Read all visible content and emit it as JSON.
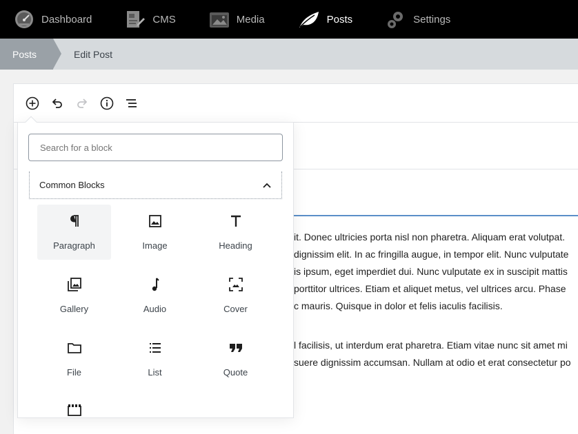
{
  "nav": {
    "items": [
      {
        "label": "Dashboard",
        "icon": "speedometer-icon",
        "active": false
      },
      {
        "label": "CMS",
        "icon": "cms-icon",
        "active": false
      },
      {
        "label": "Media",
        "icon": "media-icon",
        "active": false
      },
      {
        "label": "Posts",
        "icon": "leaf-icon",
        "active": true
      },
      {
        "label": "Settings",
        "icon": "gears-icon",
        "active": false
      }
    ]
  },
  "breadcrumb": {
    "parent": "Posts",
    "current": "Edit Post"
  },
  "toolbar": {
    "icons": [
      "add-block-icon",
      "undo-icon",
      "redo-icon",
      "info-icon",
      "outline-icon"
    ]
  },
  "inserter": {
    "search_placeholder": "Search for a block",
    "panel_title": "Common Blocks",
    "blocks": [
      {
        "label": "Paragraph",
        "icon": "paragraph-icon"
      },
      {
        "label": "Image",
        "icon": "image-icon"
      },
      {
        "label": "Heading",
        "icon": "heading-icon"
      },
      {
        "label": "Gallery",
        "icon": "gallery-icon"
      },
      {
        "label": "Audio",
        "icon": "audio-icon"
      },
      {
        "label": "Cover",
        "icon": "cover-icon"
      },
      {
        "label": "File",
        "icon": "folder-icon"
      },
      {
        "label": "List",
        "icon": "list-icon"
      },
      {
        "label": "Quote",
        "icon": "quote-icon"
      },
      {
        "label": "",
        "icon": "video-icon"
      }
    ]
  },
  "content": {
    "para1": [
      "it. Donec ultricies porta nisl non pharetra. Aliquam erat volutpat.",
      "dignissim elit. In ac fringilla augue, in tempor elit. Nunc vulputate",
      "is ipsum, eget imperdiet dui. Nunc vulputate ex in suscipit mattis",
      "porttitor ultrices. Etiam et aliquet metus, vel ultrices arcu. Phase",
      "c mauris. Quisque in dolor et felis iaculis facilisis."
    ],
    "para2": [
      "l facilisis, ut interdum erat pharetra. Etiam vitae nunc sit amet mi",
      "suere dignissim accumsan. Nullam at odio et erat consectetur po"
    ]
  }
}
